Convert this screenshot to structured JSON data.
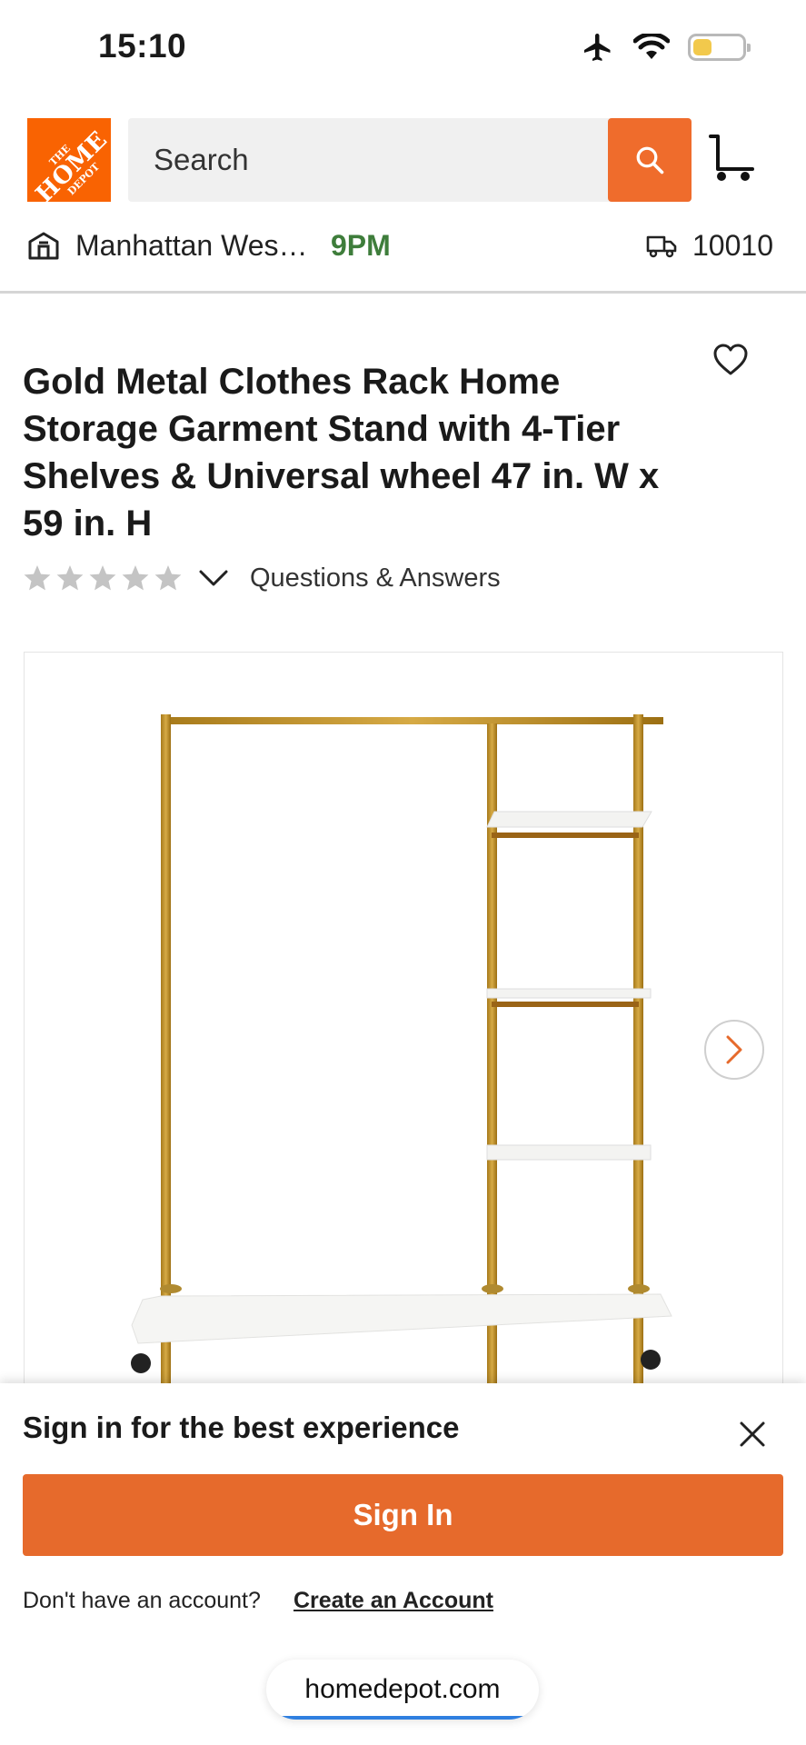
{
  "status_bar": {
    "time": "15:10",
    "icons": [
      "airplane-icon",
      "wifi-icon",
      "battery-icon"
    ],
    "battery_color": "#f2c94c"
  },
  "header": {
    "logo": {
      "lines": [
        "THE",
        "HOME",
        "DEPOT"
      ],
      "color": "#f96302"
    },
    "search_placeholder": "Search",
    "search_icon": "search-icon",
    "cart_icon": "cart-icon",
    "accent": "#ef6c2c"
  },
  "store": {
    "name": "Manhattan Wes…",
    "hours": "9PM",
    "zip": "10010",
    "store_icon": "store-icon",
    "delivery_icon": "truck-icon",
    "hours_color": "#3e7d3b"
  },
  "product": {
    "title": "Gold Metal Clothes Rack Home Storage Garment Stand with 4-Tier Shelves & Universal wheel 47 in. W x 59 in. H",
    "rating_stars": 5,
    "rating_value": 0,
    "qa_label": "Questions & Answers",
    "favorite_icon": "heart-icon"
  },
  "signin_sheet": {
    "title": "Sign in for the best experience",
    "button_label": "Sign In",
    "no_account_text": "Don't have an account?",
    "create_account_label": "Create an Account",
    "button_color": "#e66a2c"
  },
  "browser": {
    "domain": "homedepot.com"
  }
}
